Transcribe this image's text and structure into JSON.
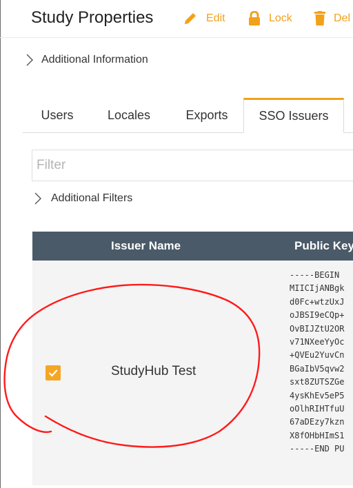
{
  "header": {
    "title": "Study Properties",
    "edit_label": "Edit",
    "lock_label": "Lock",
    "delete_label": "Del"
  },
  "additional_info": {
    "label": "Additional Information"
  },
  "tabs": [
    {
      "label": "Users"
    },
    {
      "label": "Locales"
    },
    {
      "label": "Exports"
    },
    {
      "label": "SSO Issuers",
      "active": true
    }
  ],
  "filter": {
    "placeholder": "Filter",
    "value": ""
  },
  "additional_filters": {
    "label": "Additional Filters"
  },
  "table": {
    "columns": [
      "Issuer Name",
      "Public Key"
    ],
    "column_labels_visible": [
      "Issuer Name",
      "Public Key"
    ],
    "rows": [
      {
        "checked": true,
        "issuer_name": "StudyHub Test",
        "public_key_lines": [
          "-----BEGIN",
          "MIICIjANBgk",
          "d0Fc+wtzUxJ",
          "oJBSI9eCQp+",
          "OvBIJZtU2OR",
          "v71NXeeYyOc",
          "+QVEu2YuvCn",
          "BGaIbV5qvw2",
          "sxt8ZUTSZGe",
          "4ysKhEv5eP5",
          "oOlhRIHTfuU",
          "67aDEzy7kzn",
          "X8fOHbHImS1",
          "-----END PU"
        ]
      }
    ]
  },
  "colors": {
    "accent": "#f2a11b",
    "table_header": "#4a5a68",
    "annotation": "#ff0000"
  }
}
